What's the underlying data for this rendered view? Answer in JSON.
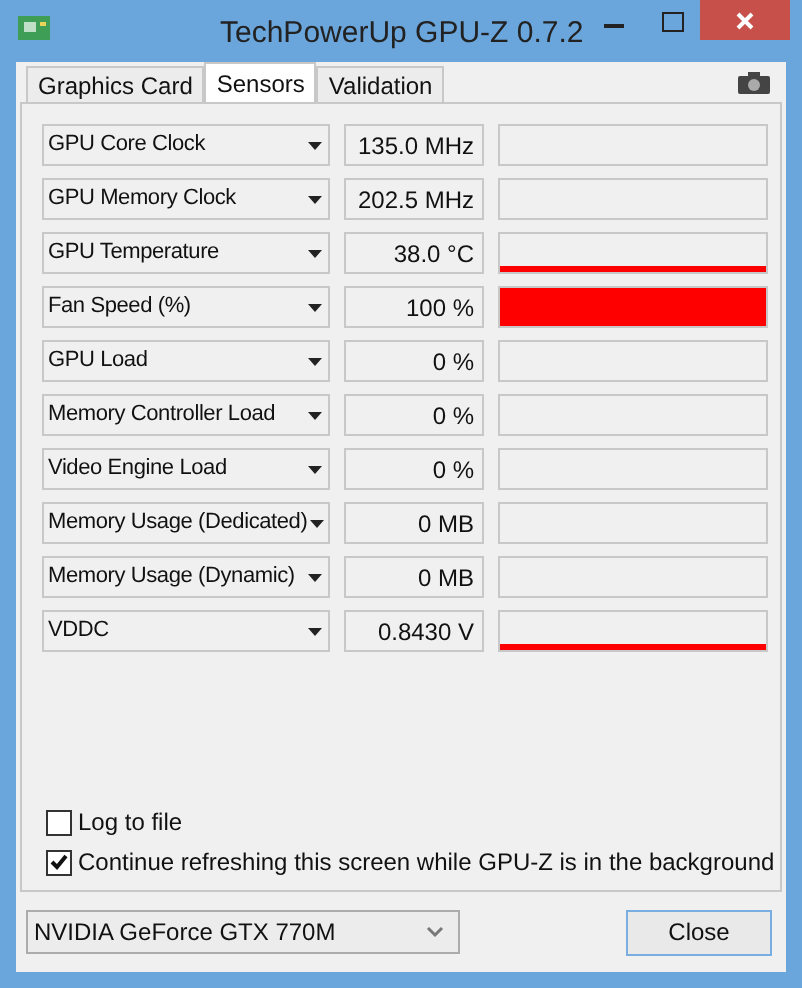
{
  "window": {
    "title": "TechPowerUp GPU-Z 0.7.2"
  },
  "tabs": [
    {
      "label": "Graphics Card",
      "selected": false
    },
    {
      "label": "Sensors",
      "selected": true
    },
    {
      "label": "Validation",
      "selected": false
    }
  ],
  "sensors": [
    {
      "name": "GPU Core Clock",
      "value": "135.0 MHz"
    },
    {
      "name": "GPU Memory Clock",
      "value": "202.5 MHz"
    },
    {
      "name": "GPU Temperature",
      "value": "38.0 °C"
    },
    {
      "name": "Fan Speed (%)",
      "value": "100 %"
    },
    {
      "name": "GPU Load",
      "value": "0 %"
    },
    {
      "name": "Memory Controller Load",
      "value": "0 %"
    },
    {
      "name": "Video Engine Load",
      "value": "0 %"
    },
    {
      "name": "Memory Usage (Dedicated)",
      "value": "0 MB"
    },
    {
      "name": "Memory Usage (Dynamic)",
      "value": "0 MB"
    },
    {
      "name": "VDDC",
      "value": "0.8430 V"
    }
  ],
  "options": [
    {
      "label": "Log to file",
      "checked": false
    },
    {
      "label": "Continue refreshing this screen while GPU-Z is in the background",
      "checked": true
    }
  ],
  "gpu_select": {
    "value": "NVIDIA GeForce GTX 770M"
  },
  "buttons": [
    {
      "label": "Close"
    }
  ]
}
